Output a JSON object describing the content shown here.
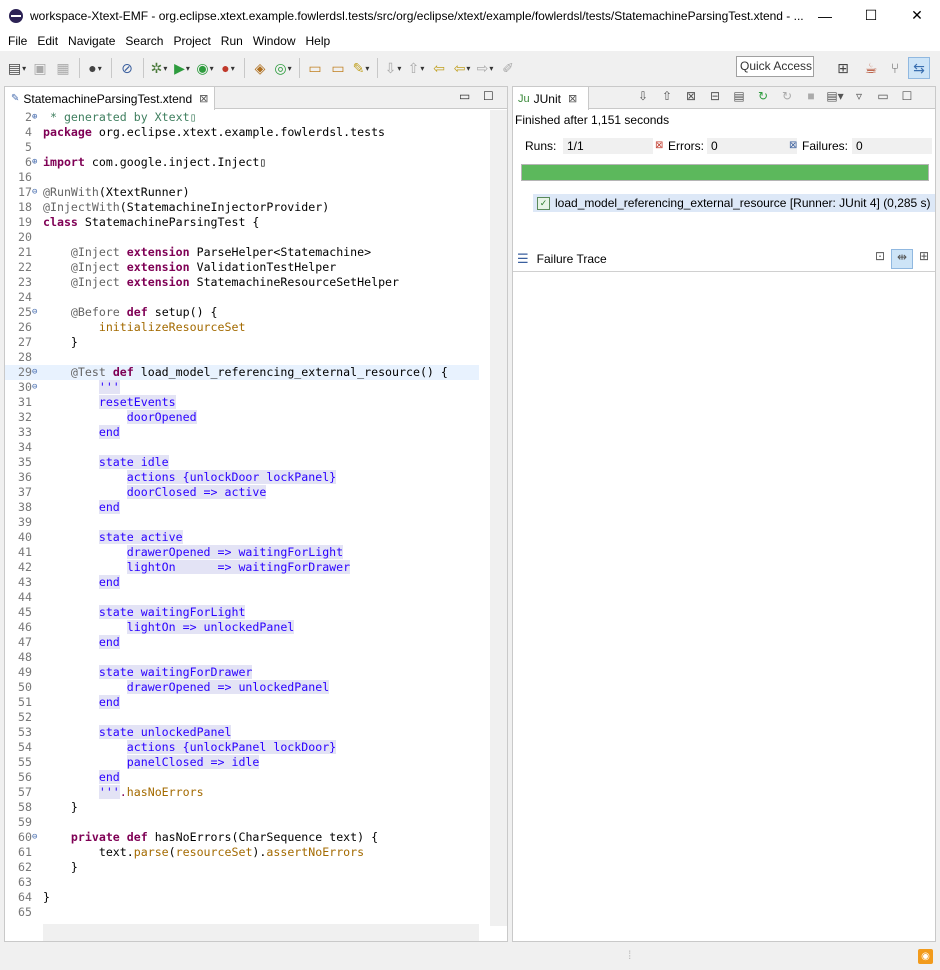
{
  "window": {
    "title": "workspace-Xtext-EMF - org.eclipse.xtext.example.fowlerdsl.tests/src/org/eclipse/xtext/example/fowlerdsl/tests/StatemachineParsingTest.xtend - ...",
    "minimize": "—",
    "maximize": "☐",
    "close": "✕"
  },
  "menu": [
    "File",
    "Edit",
    "Navigate",
    "Search",
    "Project",
    "Run",
    "Window",
    "Help"
  ],
  "quick_access": "Quick Access",
  "editor": {
    "tab_label": "StatemachineParsingTest.xtend",
    "tab_close": "⊠",
    "lines": [
      {
        "n": "2",
        "f": "⊕",
        "t": " * generated by Xtext▯"
      },
      {
        "n": "4",
        "f": "",
        "t": "package org.eclipse.xtext.example.fowlerdsl.tests"
      },
      {
        "n": "5",
        "f": "",
        "t": ""
      },
      {
        "n": "6",
        "f": "⊕",
        "t": "import com.google.inject.Inject▯"
      },
      {
        "n": "16",
        "f": "",
        "t": ""
      },
      {
        "n": "17",
        "f": "⊖",
        "t": "@RunWith(XtextRunner)"
      },
      {
        "n": "18",
        "f": "",
        "t": "@InjectWith(StatemachineInjectorProvider)"
      },
      {
        "n": "19",
        "f": "",
        "t": "class StatemachineParsingTest {"
      },
      {
        "n": "20",
        "f": "",
        "t": ""
      },
      {
        "n": "21",
        "f": "",
        "t": "    @Inject extension ParseHelper<Statemachine>"
      },
      {
        "n": "22",
        "f": "",
        "t": "    @Inject extension ValidationTestHelper"
      },
      {
        "n": "23",
        "f": "",
        "t": "    @Inject extension StatemachineResourceSetHelper"
      },
      {
        "n": "24",
        "f": "",
        "t": ""
      },
      {
        "n": "25",
        "f": "⊖",
        "t": "    @Before def setup() {"
      },
      {
        "n": "26",
        "f": "",
        "t": "        initializeResourceSet"
      },
      {
        "n": "27",
        "f": "",
        "t": "    }"
      },
      {
        "n": "28",
        "f": "",
        "t": ""
      },
      {
        "n": "29",
        "f": "⊖",
        "t": "    @Test def load_model_referencing_external_resource() {"
      },
      {
        "n": "30",
        "f": "⊖",
        "t": "        '''"
      },
      {
        "n": "31",
        "f": "",
        "t": "        resetEvents"
      },
      {
        "n": "32",
        "f": "",
        "t": "            doorOpened"
      },
      {
        "n": "33",
        "f": "",
        "t": "        end"
      },
      {
        "n": "34",
        "f": "",
        "t": ""
      },
      {
        "n": "35",
        "f": "",
        "t": "        state idle"
      },
      {
        "n": "36",
        "f": "",
        "t": "            actions {unlockDoor lockPanel}"
      },
      {
        "n": "37",
        "f": "",
        "t": "            doorClosed => active"
      },
      {
        "n": "38",
        "f": "",
        "t": "        end"
      },
      {
        "n": "39",
        "f": "",
        "t": ""
      },
      {
        "n": "40",
        "f": "",
        "t": "        state active"
      },
      {
        "n": "41",
        "f": "",
        "t": "            drawerOpened => waitingForLight"
      },
      {
        "n": "42",
        "f": "",
        "t": "            lightOn      => waitingForDrawer"
      },
      {
        "n": "43",
        "f": "",
        "t": "        end"
      },
      {
        "n": "44",
        "f": "",
        "t": ""
      },
      {
        "n": "45",
        "f": "",
        "t": "        state waitingForLight"
      },
      {
        "n": "46",
        "f": "",
        "t": "            lightOn => unlockedPanel"
      },
      {
        "n": "47",
        "f": "",
        "t": "        end"
      },
      {
        "n": "48",
        "f": "",
        "t": ""
      },
      {
        "n": "49",
        "f": "",
        "t": "        state waitingForDrawer"
      },
      {
        "n": "50",
        "f": "",
        "t": "            drawerOpened => unlockedPanel"
      },
      {
        "n": "51",
        "f": "",
        "t": "        end"
      },
      {
        "n": "52",
        "f": "",
        "t": ""
      },
      {
        "n": "53",
        "f": "",
        "t": "        state unlockedPanel"
      },
      {
        "n": "54",
        "f": "",
        "t": "            actions {unlockPanel lockDoor}"
      },
      {
        "n": "55",
        "f": "",
        "t": "            panelClosed => idle"
      },
      {
        "n": "56",
        "f": "",
        "t": "        end"
      },
      {
        "n": "57",
        "f": "",
        "t": "        '''.hasNoErrors"
      },
      {
        "n": "58",
        "f": "",
        "t": "    }"
      },
      {
        "n": "59",
        "f": "",
        "t": ""
      },
      {
        "n": "60",
        "f": "⊖",
        "t": "    private def hasNoErrors(CharSequence text) {"
      },
      {
        "n": "61",
        "f": "",
        "t": "        text.parse(resourceSet).assertNoErrors"
      },
      {
        "n": "62",
        "f": "",
        "t": "    }"
      },
      {
        "n": "63",
        "f": "",
        "t": ""
      },
      {
        "n": "64",
        "f": "",
        "t": "}"
      },
      {
        "n": "65",
        "f": "",
        "t": ""
      }
    ]
  },
  "junit": {
    "tab_label": "JUnit",
    "finished": "Finished after 1,151 seconds",
    "runs_label": "Runs:",
    "runs_value": "1/1",
    "errors_label": "Errors:",
    "errors_value": "0",
    "failures_label": "Failures:",
    "failures_value": "0",
    "progress": 1.0,
    "progress_color": "#5cb85c",
    "test_name": "load_model_referencing_external_resource [Runner: JUnit 4] (0,285 s)",
    "failure_trace": "Failure Trace"
  }
}
